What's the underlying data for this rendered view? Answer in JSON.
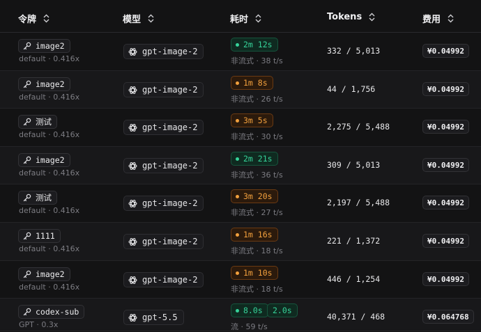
{
  "columns": {
    "token": "令牌",
    "model": "模型",
    "duration": "耗时",
    "tokens": "Tokens",
    "cost": "费用"
  },
  "icons": {
    "token": "key-icon",
    "model": "openai-icon",
    "sort": "sort-icon",
    "status": "dot-icon"
  },
  "colors": {
    "fast": "#36d399",
    "slow": "#f2a03d"
  },
  "rows": [
    {
      "token": "image2",
      "group": "default · 0.416x",
      "model": "gpt-image-2",
      "time": "2m 12s",
      "time_status": "green",
      "speed": "非流式 · 38 t/s",
      "tokens": "332 / 5,013",
      "cost": "¥0.04992"
    },
    {
      "token": "image2",
      "group": "default · 0.416x",
      "model": "gpt-image-2",
      "time": "1m 8s",
      "time_status": "orange",
      "speed": "非流式 · 26 t/s",
      "tokens": "44 / 1,756",
      "cost": "¥0.04992"
    },
    {
      "token": "测试",
      "group": "default · 0.416x",
      "model": "gpt-image-2",
      "time": "3m 5s",
      "time_status": "orange",
      "speed": "非流式 · 30 t/s",
      "tokens": "2,275 / 5,488",
      "cost": "¥0.04992"
    },
    {
      "token": "image2",
      "group": "default · 0.416x",
      "model": "gpt-image-2",
      "time": "2m 21s",
      "time_status": "green",
      "speed": "非流式 · 36 t/s",
      "tokens": "309 / 5,013",
      "cost": "¥0.04992"
    },
    {
      "token": "测试",
      "group": "default · 0.416x",
      "model": "gpt-image-2",
      "time": "3m 20s",
      "time_status": "orange",
      "speed": "非流式 · 27 t/s",
      "tokens": "2,197 / 5,488",
      "cost": "¥0.04992"
    },
    {
      "token": "1111",
      "group": "default · 0.416x",
      "model": "gpt-image-2",
      "time": "1m 16s",
      "time_status": "orange",
      "speed": "非流式 · 18 t/s",
      "tokens": "221 / 1,372",
      "cost": "¥0.04992"
    },
    {
      "token": "image2",
      "group": "default · 0.416x",
      "model": "gpt-image-2",
      "time": "1m 10s",
      "time_status": "orange",
      "speed": "非流式 · 18 t/s",
      "tokens": "446 / 1,254",
      "cost": "¥0.04992"
    },
    {
      "token": "codex-sub",
      "group": "GPT · 0.3x",
      "model": "gpt-5.5",
      "time": "8.0s",
      "time_status": "green",
      "time2": "2.0s",
      "speed": "流 · 59 t/s",
      "tokens": "40,371 / 468",
      "cost": "¥0.064768"
    }
  ]
}
